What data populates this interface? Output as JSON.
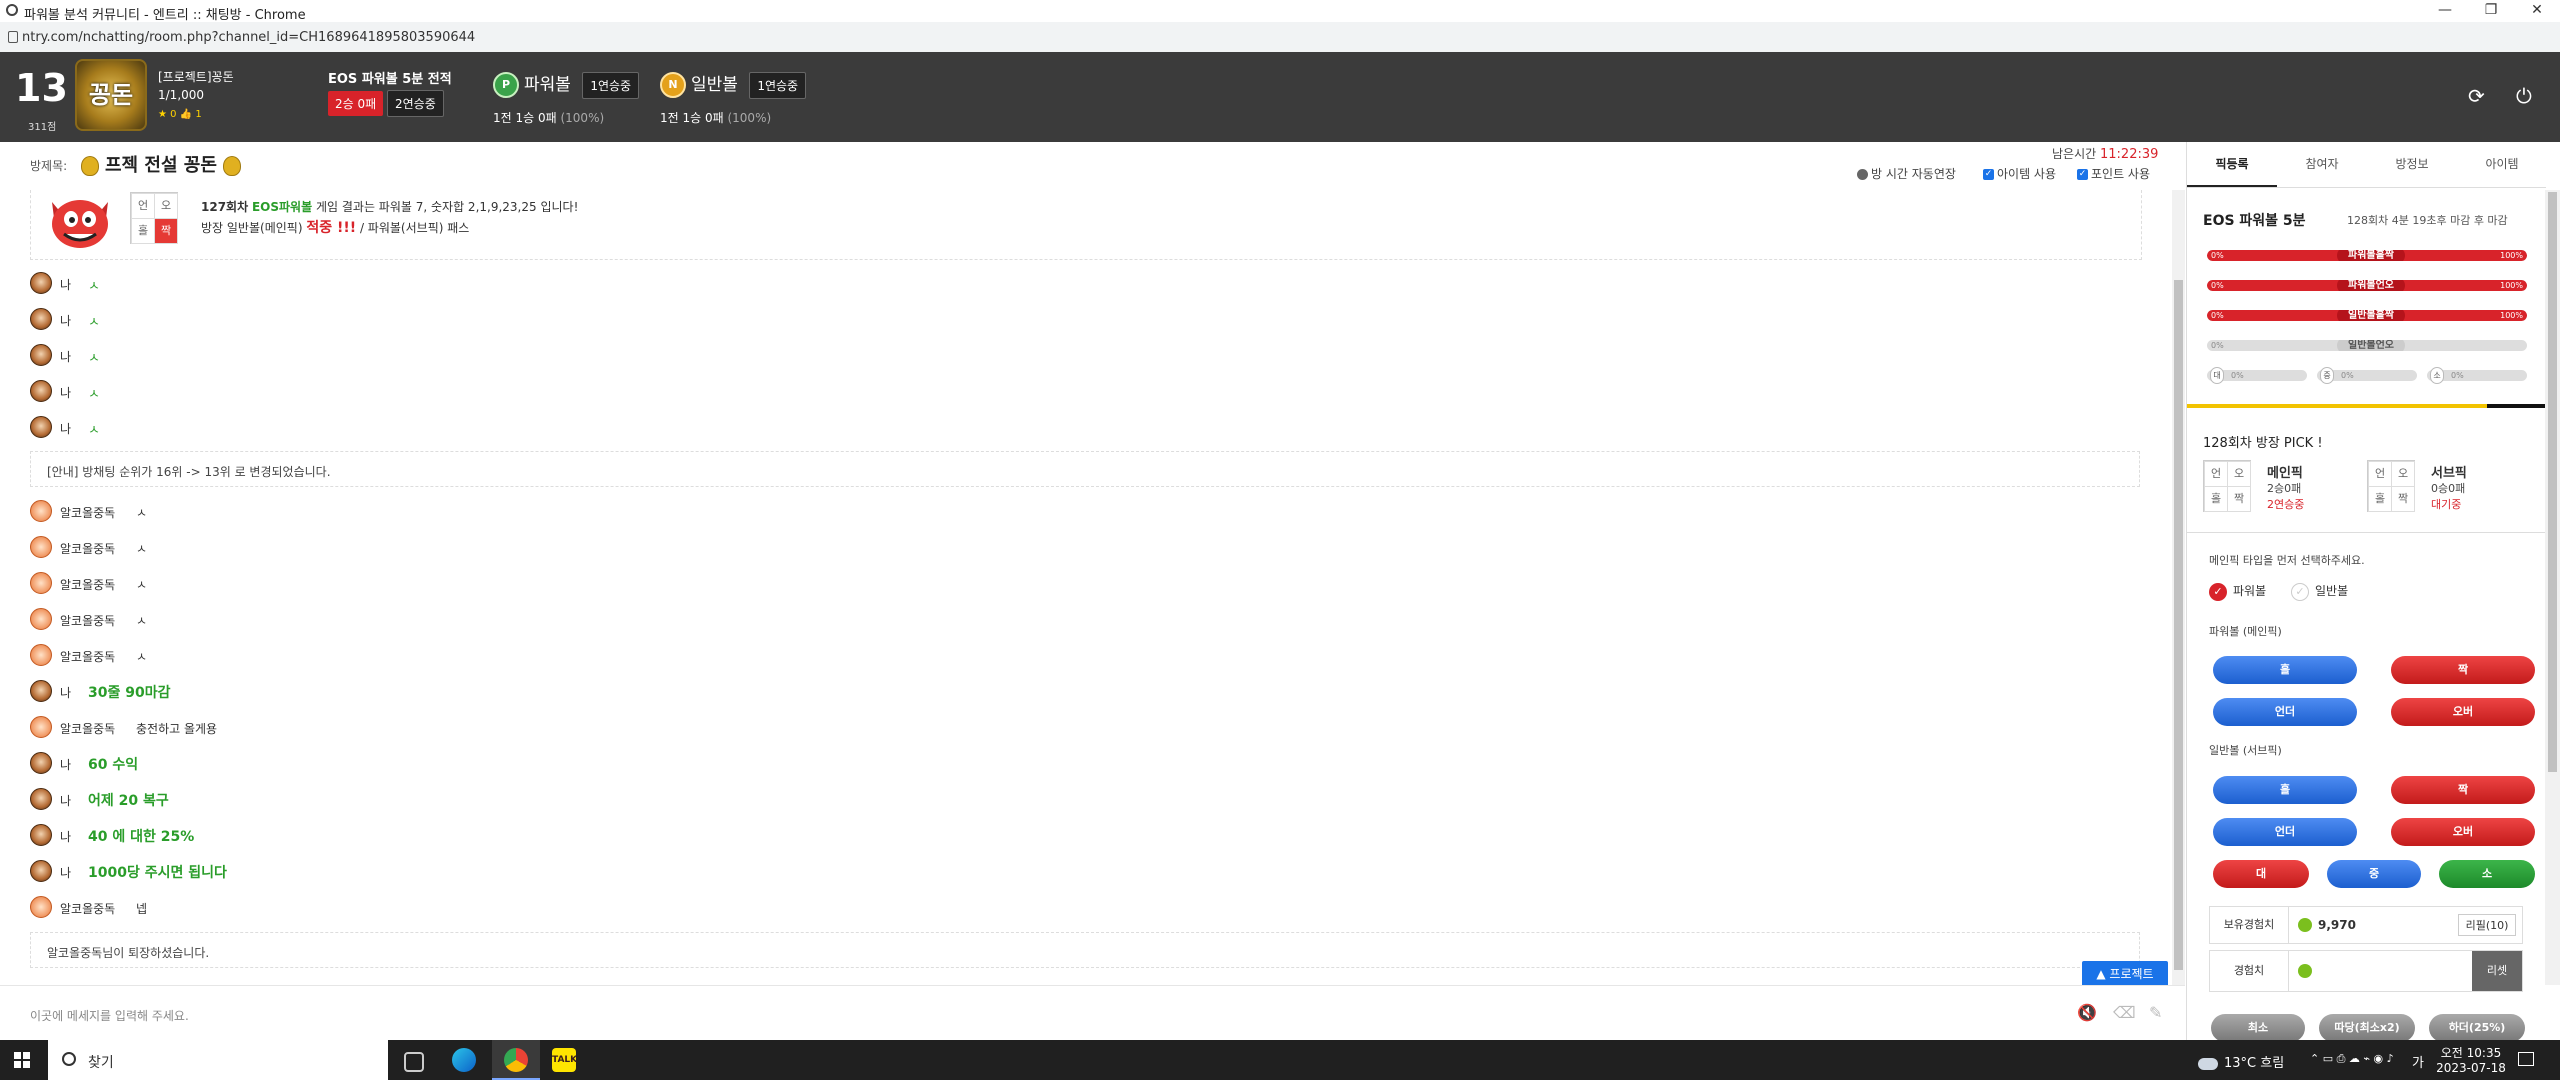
{
  "browser": {
    "title": "파워볼 분석 커뮤니티 - 엔트리 :: 채팅방 - Chrome",
    "url": "ntry.com/nchatting/room.php?channel_id=CH1689641895803590644",
    "win_min": "—",
    "win_max": "❐",
    "win_close": "✕"
  },
  "header": {
    "rank": "13",
    "points": "311점",
    "avatar_text": "꽁돈",
    "nickname": "[프로젝트]꽁돈",
    "level": "1/1,000",
    "stars": "★ 0   👍 1",
    "record_title": "EOS 파워볼 5분 전적",
    "record_win": "2승 0패",
    "record_streak": "2연승중",
    "powerball_label": "파워볼",
    "powerball_icon": "P",
    "powerball_streak": "1연승중",
    "powerball_sub": "1전 1승 0패",
    "powerball_pct": "(100%)",
    "normal_label": "일반볼",
    "normal_icon": "N",
    "normal_streak": "1연승중",
    "normal_sub": "1전 1승 0패",
    "normal_pct": "(100%)",
    "refresh_icon": "⟳",
    "power_icon": "⏻"
  },
  "room": {
    "label": "방제목:",
    "title": "프젝 전설 꽁돈",
    "remain_label": "남은시간",
    "remain_time": "11:22:39",
    "opt_extend": "방 시간 자동연장",
    "opt_item": "아이템 사용",
    "opt_point": "포인트 사용"
  },
  "result": {
    "round": "127회차",
    "game": "EOS파워볼",
    "text": "게임 결과는 파워볼 7, 숫자합 2,1,9,23,25 입니다!",
    "line2_pre": "방장 일반볼(메인픽)",
    "hit": "적중 !!!",
    "line2_post": "/ 파워볼(서브픽) 패스",
    "grid": [
      "언",
      "오",
      "홀",
      "짝"
    ]
  },
  "notice1": "[안내] 방채팅 순위가 16위 -> 13위 로 변경되었습니다.",
  "notice2": "알코올중독님이 퇴장하셨습니다.",
  "messages_me": [
    {
      "name": "나",
      "text": "ㅅ"
    },
    {
      "name": "나",
      "text": "ㅅ"
    },
    {
      "name": "나",
      "text": "ㅅ"
    },
    {
      "name": "나",
      "text": "ㅅ"
    },
    {
      "name": "나",
      "text": "ㅅ"
    }
  ],
  "messages_other": [
    {
      "name": "알코올중독",
      "text": "ㅅ"
    },
    {
      "name": "알코올중독",
      "text": "ㅅ"
    },
    {
      "name": "알코올중독",
      "text": "ㅅ"
    },
    {
      "name": "알코올중독",
      "text": "ㅅ"
    },
    {
      "name": "알코올중독",
      "text": "ㅅ"
    }
  ],
  "messages_mix": [
    {
      "name": "나",
      "text": "30줄 90마감",
      "me": true
    },
    {
      "name": "알코올중독",
      "text": "충전하고 올게용",
      "me": false
    },
    {
      "name": "나",
      "text": "60 수익",
      "me": true
    },
    {
      "name": "나",
      "text": "어제 20 복구",
      "me": true
    },
    {
      "name": "나",
      "text": "40 에 대한 25%",
      "me": true
    },
    {
      "name": "나",
      "text": "1000당 주시면 됩니다",
      "me": true
    },
    {
      "name": "알코올중독",
      "text": "넵",
      "me": false
    }
  ],
  "chat": {
    "placeholder": "이곳에 메세지를 입력해 주세요.",
    "project_btn": "▲ 프로젝트"
  },
  "panel": {
    "tabs": [
      "픽등록",
      "참여자",
      "방정보",
      "아이템"
    ],
    "game_title": "EOS 파워볼 5분",
    "game_info": "128회차 4분 19초후 마감 후 마감",
    "bars": [
      {
        "label": "파워볼홀짝",
        "left": "0%",
        "right": "100%",
        "pct": 100
      },
      {
        "label": "파워볼언오",
        "left": "0%",
        "right": "100%",
        "pct": 100
      },
      {
        "label": "일반볼홀짝",
        "left": "0%",
        "right": "100%",
        "pct": 100
      },
      {
        "label": "일반볼언오",
        "left": "0%",
        "right": "",
        "pct": 0
      }
    ],
    "mini": [
      {
        "tag": "대",
        "pct": "0%"
      },
      {
        "tag": "중",
        "pct": "0%"
      },
      {
        "tag": "소",
        "pct": "0%"
      }
    ],
    "pick_title": "128회차 방장 PICK !",
    "main_pick": "메인픽",
    "main_rec": "2승0패",
    "main_streak": "2연승중",
    "sub_pick": "서브픽",
    "sub_rec": "0승0패",
    "sub_status": "대기중",
    "pick_grid": [
      "언",
      "오",
      "홀",
      "짝"
    ],
    "select_prompt": "메인픽 타입을 먼저 선택하주세요.",
    "radio_power": "파워볼",
    "radio_normal": "일반볼",
    "power_main_label": "파워볼 (메인픽)",
    "normal_sub_label": "일반볼 (서브픽)",
    "btn_odd": "홀",
    "btn_even": "짝",
    "btn_under": "언더",
    "btn_over": "오버",
    "btn_big": "대",
    "btn_mid": "중",
    "btn_small": "소",
    "xp_label": "보유경험치",
    "xp_value": "9,970",
    "xp_refill": "리필(10)",
    "xp2_label": "경험치",
    "xp_reset": "리셋",
    "bottom_btns": [
      "최소",
      "따당(최소x2)",
      "하더(25%)"
    ]
  },
  "taskbar": {
    "search": "찾기",
    "weather": "13°C 흐림",
    "lang": "가",
    "time": "오전 10:35",
    "date": "2023-07-18"
  }
}
